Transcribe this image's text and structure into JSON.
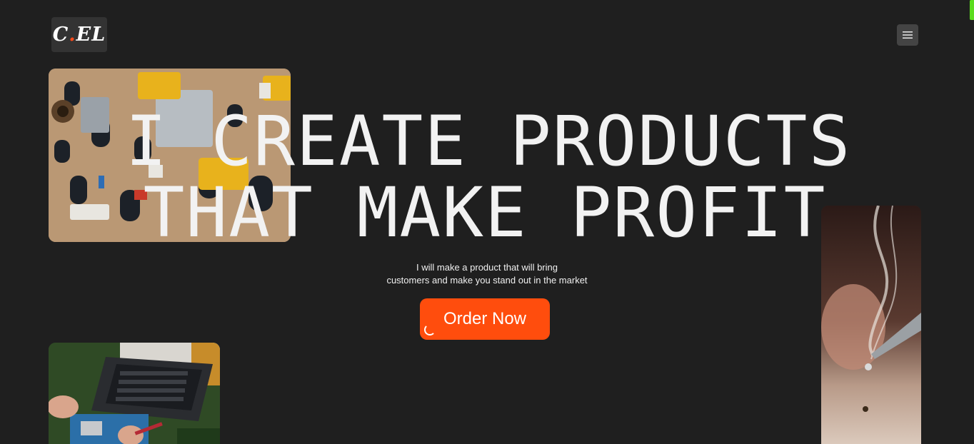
{
  "header": {
    "logo_main": "C",
    "logo_dot": ".",
    "logo_tail": "EL",
    "menu_icon": "hamburger-icon"
  },
  "hero": {
    "headline_line1": "I CREATE PRODUCTS",
    "headline_line2": "THAT MAKE PROFIT",
    "subtitle_line1": "I will make a product that will bring",
    "subtitle_line2": "customers and make you stand out in the market",
    "cta_label": "Order Now"
  },
  "colors": {
    "background": "#1f1f1f",
    "accent": "#ff4d0d",
    "logo_bg": "#333333",
    "scroll_indicator": "#5bdc1e"
  }
}
